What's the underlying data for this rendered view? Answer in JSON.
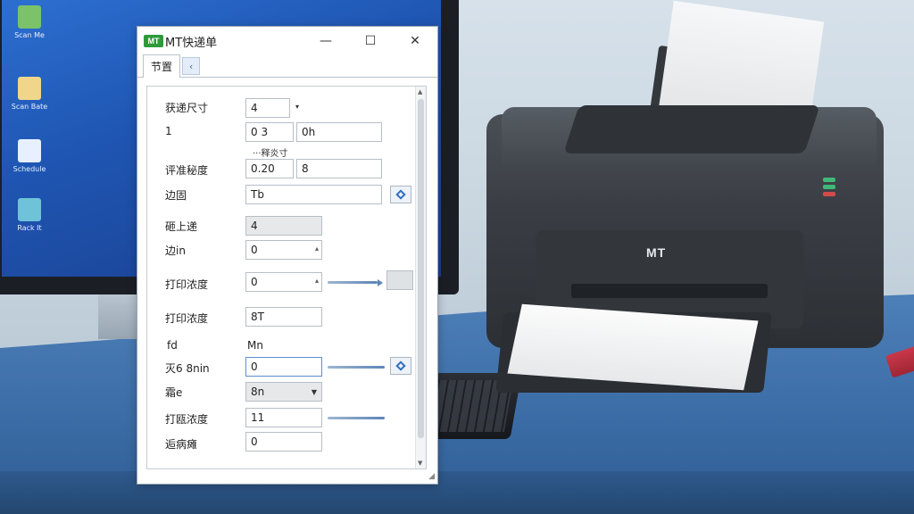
{
  "window": {
    "logo": "MT",
    "title": "MT快递单",
    "minimize": "—",
    "maximize": "☐",
    "close": "✕"
  },
  "tabs": [
    {
      "label": "节置"
    }
  ],
  "tab_arrow": "‹",
  "form": {
    "row1": {
      "label": "获递尺寸",
      "value": "4",
      "mark": "▾"
    },
    "row2": {
      "label": "1",
      "value_a": "0     3",
      "value_b": "0h"
    },
    "note": "···释炎寸",
    "row3": {
      "label": "评准秘度",
      "value_a": "0.20",
      "value_b": "8"
    },
    "row4": {
      "label": "边固",
      "value": "Tb"
    },
    "row5": {
      "label": "砸上递",
      "value": "4"
    },
    "row6": {
      "label": "边in",
      "value": "0"
    },
    "row7": {
      "label": "打印浓度",
      "value": "0"
    },
    "row8": {
      "label": "打印浓度",
      "value": "8T"
    },
    "row9": {
      "label": "fd",
      "value": "Mn"
    },
    "row10": {
      "label": "灭6 8nin",
      "value": "0"
    },
    "row11": {
      "label": "霜e",
      "value": "8n"
    },
    "row12": {
      "label": "打瓯浓度",
      "value": "11"
    },
    "row13": {
      "label": "逅病瘫",
      "value": "0"
    }
  },
  "desktop_icons": [
    "Scan Me",
    "Scan Bate",
    "Schedule",
    "Rack It"
  ],
  "printer_brand": "MT",
  "colors": {
    "accent": "#2f6fc0",
    "logo_green": "#2f9a3a",
    "desk_blue": "#3f70a9"
  }
}
